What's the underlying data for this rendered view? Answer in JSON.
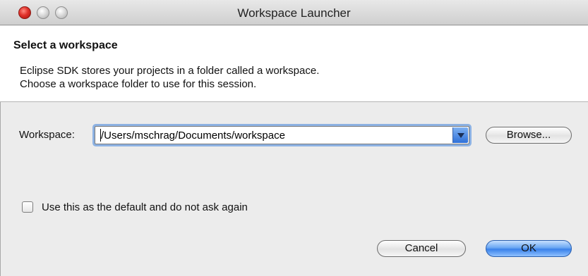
{
  "window": {
    "title": "Workspace Launcher"
  },
  "header": {
    "title": "Select a workspace",
    "description_line1": "Eclipse SDK stores your projects in a folder called a workspace.",
    "description_line2": "Choose a workspace folder to use for this session."
  },
  "workspace": {
    "label": "Workspace:",
    "value": "/Users/mschrag/Documents/workspace",
    "browse_label": "Browse..."
  },
  "default_checkbox": {
    "label": "Use this as the default and do not ask again",
    "checked": false
  },
  "actions": {
    "cancel_label": "Cancel",
    "ok_label": "OK"
  },
  "colors": {
    "accent": "#3a82ea",
    "focus_ring": "#8db2e3",
    "close_button": "#e0312a"
  }
}
